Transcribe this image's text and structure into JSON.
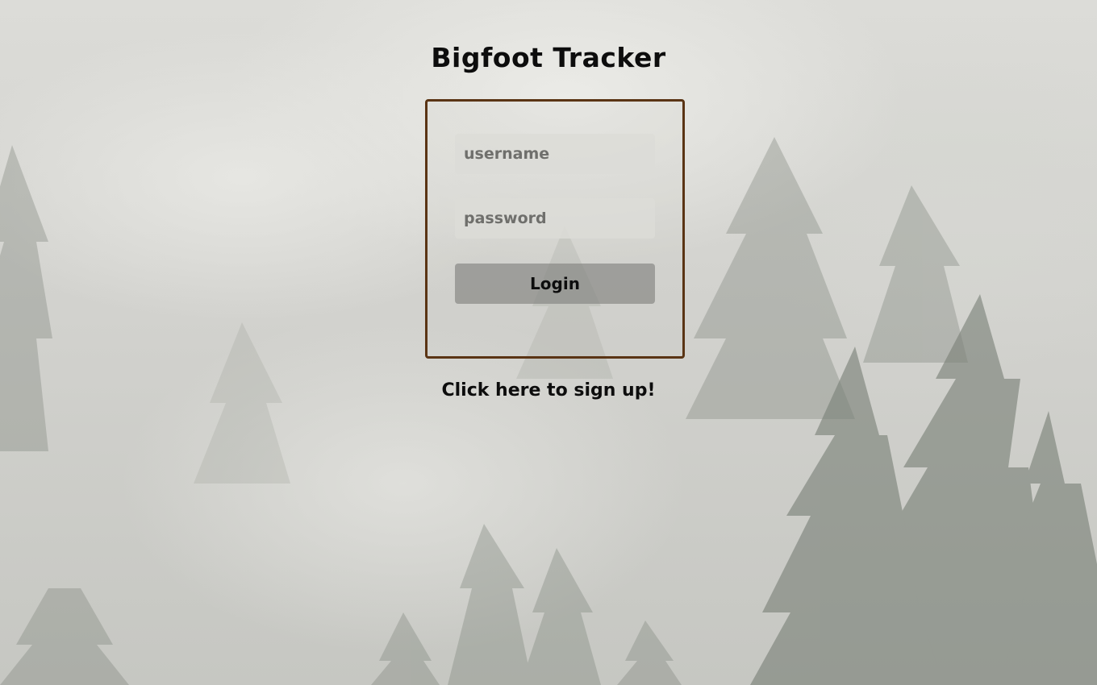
{
  "page": {
    "title": "Bigfoot Tracker"
  },
  "login_form": {
    "username_placeholder": "username",
    "password_placeholder": "password",
    "login_label": "Login"
  },
  "signup": {
    "link_text": "Click here to sign up!"
  },
  "colors": {
    "box_border": "#5a3414",
    "text": "#0d0d0d",
    "button_bg": "#82827f"
  },
  "background": {
    "description_icon": "misty-forest-image"
  }
}
